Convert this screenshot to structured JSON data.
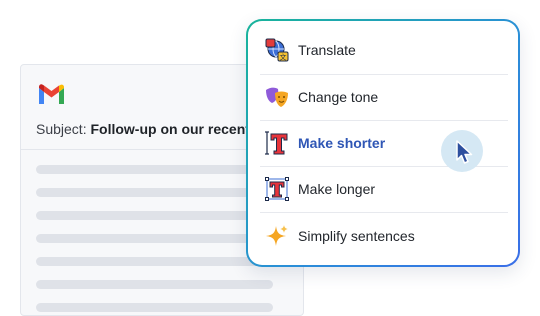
{
  "email": {
    "subject_label": "Subject:",
    "subject_value": "Follow-up on our recent"
  },
  "menu": {
    "items": [
      {
        "label": "Translate",
        "icon": "translate-globe-icon"
      },
      {
        "label": "Change tone",
        "icon": "theater-masks-icon"
      },
      {
        "label": "Make shorter",
        "icon": "shorten-text-icon",
        "active": true
      },
      {
        "label": "Make longer",
        "icon": "lengthen-text-icon"
      },
      {
        "label": "Simplify sentences",
        "icon": "sparkle-icon"
      }
    ]
  },
  "colors": {
    "accent": "#2f56b5",
    "menu_border_start": "#18b49a",
    "menu_border_end": "#3a6ee8"
  }
}
